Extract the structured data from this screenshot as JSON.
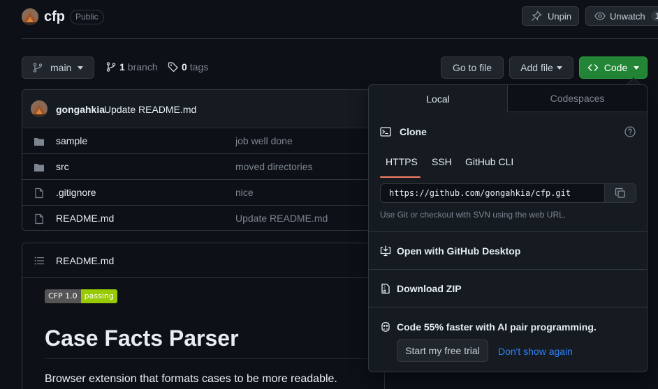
{
  "repo": {
    "name": "cfp",
    "visibility": "Public"
  },
  "header_actions": {
    "unpin": "Unpin",
    "unwatch": "Unwatch",
    "watch_count": "1"
  },
  "toolbar": {
    "branch": "main",
    "branch_count": "1",
    "branch_word": "branch",
    "tag_count": "0",
    "tag_word": "tags",
    "go_to_file": "Go to file",
    "add_file": "Add file",
    "code": "Code"
  },
  "commit": {
    "author": "gongahkia",
    "message": "Update README.md"
  },
  "files": [
    {
      "name": "sample",
      "type": "folder",
      "message": "job well done"
    },
    {
      "name": "src",
      "type": "folder",
      "message": "moved directories"
    },
    {
      "name": ".gitignore",
      "type": "file",
      "message": "nice"
    },
    {
      "name": "README.md",
      "type": "file",
      "message": "Update README.md"
    }
  ],
  "readme": {
    "filename": "README.md",
    "badge_left": "CFP 1.0",
    "badge_right": "passing",
    "title": "Case Facts Parser",
    "description": "Browser extension that formats cases to be more readable."
  },
  "code_panel": {
    "tab_local": "Local",
    "tab_codespaces": "Codespaces",
    "clone_title": "Clone",
    "proto_https": "HTTPS",
    "proto_ssh": "SSH",
    "proto_cli": "GitHub CLI",
    "clone_url": "https://github.com/gongahkia/cfp.git",
    "hint": "Use Git or checkout with SVN using the web URL.",
    "open_desktop": "Open with GitHub Desktop",
    "download_zip": "Download ZIP",
    "copilot_text": "Code 55% faster with AI pair programming.",
    "trial_button": "Start my free trial",
    "dismiss_link": "Don't show again"
  },
  "colors": {
    "background": "#0d1117",
    "surface": "#161b22",
    "border": "#30363d",
    "accent_green": "#238636",
    "link_blue": "#2f81f7",
    "underline_orange": "#f78166",
    "badge_green": "#97ca00"
  }
}
